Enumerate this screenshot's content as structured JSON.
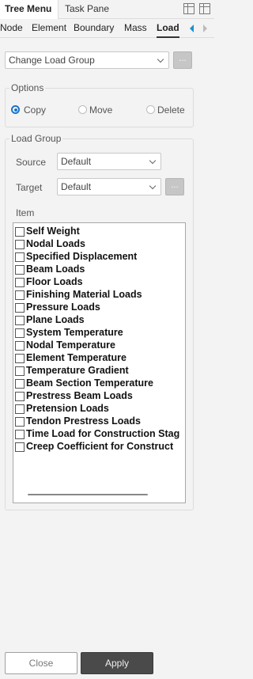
{
  "top_tabs": {
    "active": "Tree Menu",
    "inactive": "Task Pane"
  },
  "sub_tabs": [
    "Node",
    "Element",
    "Boundary",
    "Mass",
    "Load"
  ],
  "change_load_group": {
    "value": "Change Load Group",
    "dots": "..."
  },
  "options": {
    "legend": "Options",
    "radios": [
      {
        "label": "Copy",
        "selected": true
      },
      {
        "label": "Move",
        "selected": false
      },
      {
        "label": "Delete",
        "selected": false
      }
    ]
  },
  "load_group": {
    "legend": "Load Group",
    "source": {
      "label": "Source",
      "value": "Default"
    },
    "target": {
      "label": "Target",
      "value": "Default",
      "dots": "..."
    },
    "item_label": "Item",
    "items": [
      "Self Weight",
      "Nodal Loads",
      "Specified Displacement",
      "Beam Loads",
      "Floor Loads",
      "Finishing Material Loads",
      "Pressure Loads",
      "Plane Loads",
      "System Temperature",
      "Nodal Temperature",
      "Element Temperature",
      "Temperature Gradient",
      "Beam Section Temperature",
      "Prestress Beam Loads",
      "Pretension Loads",
      "Tendon Prestress Loads",
      "Time Load for Construction Stag",
      "Creep Coefficient for Construct"
    ]
  },
  "buttons": {
    "close": "Close",
    "apply": "Apply"
  },
  "colors": {
    "accent": "#1a73c9",
    "arrow_active": "#1a8fd1",
    "apply_bg": "#4a4a4a"
  }
}
